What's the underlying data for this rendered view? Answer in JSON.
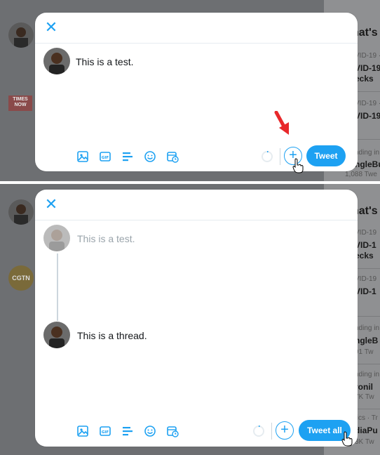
{
  "colors": {
    "accent": "#1da1f2",
    "text": "#14171a",
    "muted": "#9aa4ab",
    "arrow": "#e8282b"
  },
  "top": {
    "composer": {
      "text": "This is a test."
    },
    "tweet_button": "Tweet",
    "toolbar_icons": [
      "image-icon",
      "gif-icon",
      "poll-icon",
      "emoji-icon",
      "schedule-icon"
    ]
  },
  "bottom": {
    "first_tweet": {
      "text": "This is a test."
    },
    "second_tweet": {
      "text": "This is a thread."
    },
    "tweet_button": "Tweet all",
    "toolbar_icons": [
      "image-icon",
      "gif-icon",
      "poll-icon",
      "emoji-icon",
      "schedule-icon"
    ]
  },
  "background": {
    "top_trends": {
      "heading": "hat's",
      "items": [
        {
          "small": "VID-19 ·",
          "big": "VID-19"
        },
        {
          "small": "",
          "big": "ecks"
        },
        {
          "small": "VID-19 ·",
          "big": "VID-19"
        },
        {
          "small": "nding in",
          "big": "ngleBu"
        },
        {
          "small": "1,088 Twe",
          "big": ""
        }
      ],
      "logo_text": "TIMES NOW"
    },
    "bottom_trends": {
      "heading": "hat's",
      "items": [
        {
          "small": "VID-19",
          "big": "VID-1"
        },
        {
          "small": "",
          "big": "ecks"
        },
        {
          "small": "VID-19",
          "big": "VID-1"
        },
        {
          "small": "nding in",
          "big": "ngleB"
        },
        {
          "small": "91 Tw",
          "big": ""
        },
        {
          "small": "nding in",
          "big": "ronil"
        },
        {
          "small": "7K Tw",
          "big": ""
        },
        {
          "small": "tics · Tr",
          "big": "diaPu"
        },
        {
          "small": "3K Tw",
          "big": ""
        }
      ],
      "logo_text": "CGTN"
    }
  }
}
